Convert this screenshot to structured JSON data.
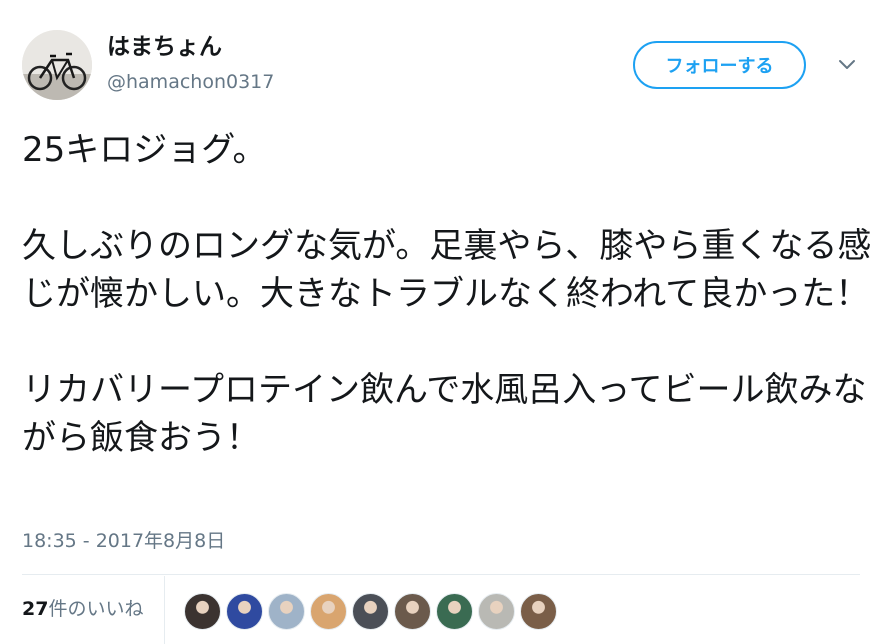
{
  "user": {
    "display_name": "はまちょん",
    "screen_name": "@hamachon0317",
    "avatar_icon": "bicycle-avatar"
  },
  "follow_button": {
    "label": "フォローする"
  },
  "menu": {
    "icon": "chevron-down-icon"
  },
  "tweet": {
    "paragraphs": [
      "25キロジョグ。",
      "久しぶりのロングな気が。足裏やら、膝やら重くなる感じが懐かしい。大きなトラブルなく終われて良かった！",
      "リカバリープロテイン飲んで水風呂入ってビール飲みながら飯食おう！"
    ],
    "timestamp": "18:35 - 2017年8月8日"
  },
  "likes": {
    "count": "27",
    "suffix": "件のいいね",
    "liker_avatars": [
      {
        "name": "liker-avatar-1",
        "color": "#3b3330"
      },
      {
        "name": "liker-avatar-2",
        "color": "#2f4aa0"
      },
      {
        "name": "liker-avatar-3",
        "color": "#9fb3c8"
      },
      {
        "name": "liker-avatar-4",
        "color": "#d9a56f"
      },
      {
        "name": "liker-avatar-5",
        "color": "#4b4f57"
      },
      {
        "name": "liker-avatar-6",
        "color": "#6b5a4c"
      },
      {
        "name": "liker-avatar-7",
        "color": "#3a6b52"
      },
      {
        "name": "liker-avatar-8",
        "color": "#b9b9b4"
      },
      {
        "name": "liker-avatar-9",
        "color": "#7a5e48"
      }
    ]
  },
  "colors": {
    "accent": "#1da1f2",
    "secondary_text": "#657786",
    "primary_text": "#14171a",
    "divider": "#e6ecf0"
  }
}
